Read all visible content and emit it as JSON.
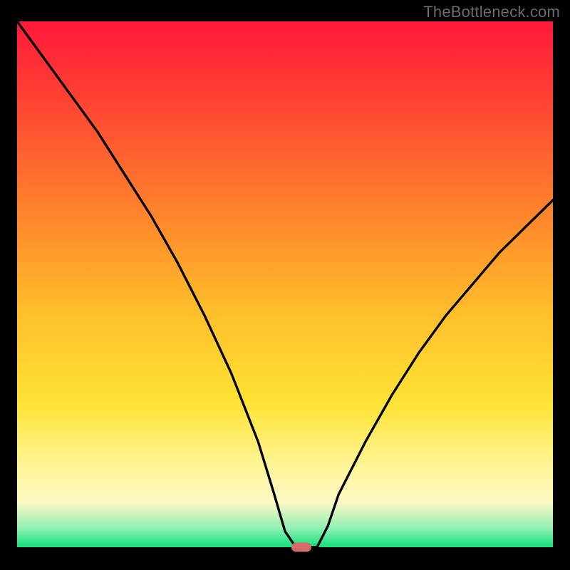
{
  "watermark": "TheBottleneck.com",
  "colors": {
    "black": "#000000",
    "red_top": "#ff1a3a",
    "red_upper": "#ff3a33",
    "orange": "#ff8a2b",
    "amber": "#ffbf2b",
    "yellow": "#ffe335",
    "pale_yellow": "#fff59a",
    "cream": "#fbf8c4",
    "mint": "#8ef0b4",
    "green": "#1de27f",
    "marker": "#d66b6b",
    "curve": "#000000",
    "watermark_text": "#6b6b6b"
  },
  "chart_data": {
    "type": "line",
    "title": "",
    "xlabel": "",
    "ylabel": "",
    "xlim": [
      0,
      100
    ],
    "ylim": [
      0,
      100
    ],
    "x": [
      0,
      5,
      10,
      15,
      20,
      25,
      30,
      35,
      40,
      45,
      48,
      50,
      52,
      54,
      56,
      58,
      60,
      65,
      70,
      75,
      80,
      85,
      90,
      95,
      100
    ],
    "values": [
      100,
      93,
      86,
      79,
      71,
      63,
      54,
      44,
      33,
      20,
      10,
      3,
      0,
      0,
      0,
      4,
      10,
      20,
      29,
      37,
      44,
      50,
      56,
      61,
      66
    ],
    "minimum": {
      "x": 53,
      "y": 0
    },
    "grid": false,
    "legend": false,
    "annotations": [
      "TheBottleneck.com"
    ]
  }
}
